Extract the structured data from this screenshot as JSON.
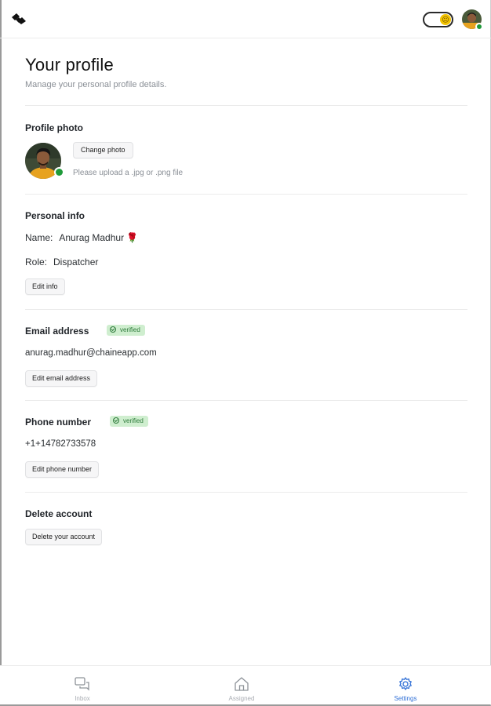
{
  "header": {
    "logo_icon": "chaine-logo-icon",
    "theme_toggle_icon": "sun-face-icon",
    "theme_toggle_on": true,
    "toggle_knob_emoji": "😐"
  },
  "page": {
    "title": "Your profile",
    "subtitle": "Manage your personal profile details."
  },
  "profile_photo": {
    "title": "Profile photo",
    "change_label": "Change photo",
    "hint": "Please upload a .jpg or .png file"
  },
  "personal_info": {
    "title": "Personal info",
    "name_key": "Name:",
    "name_value": "Anurag Madhur 🌹",
    "role_key": "Role:",
    "role_value": "Dispatcher",
    "edit_label": "Edit info"
  },
  "email": {
    "title": "Email address",
    "badge": "verified",
    "value": "anurag.madhur@chaineapp.com",
    "edit_label": "Edit email address"
  },
  "phone": {
    "title": "Phone number",
    "badge": "verified",
    "value": "+1+14782733578",
    "edit_label": "Edit phone number"
  },
  "delete_account": {
    "title": "Delete account",
    "button_label": "Delete your account"
  },
  "bottom_nav": {
    "items": [
      {
        "label": "Inbox",
        "icon": "chat-bubbles-icon",
        "active": false
      },
      {
        "label": "Assigned",
        "icon": "home-icon",
        "active": false
      },
      {
        "label": "Settings",
        "icon": "gear-icon",
        "active": true
      }
    ]
  },
  "colors": {
    "accent": "#2f6fd6",
    "verified_bg": "#cfeecf",
    "verified_text": "#2d7a3a",
    "online": "#1f9a3a",
    "toggle_knob": "#f2c200"
  }
}
